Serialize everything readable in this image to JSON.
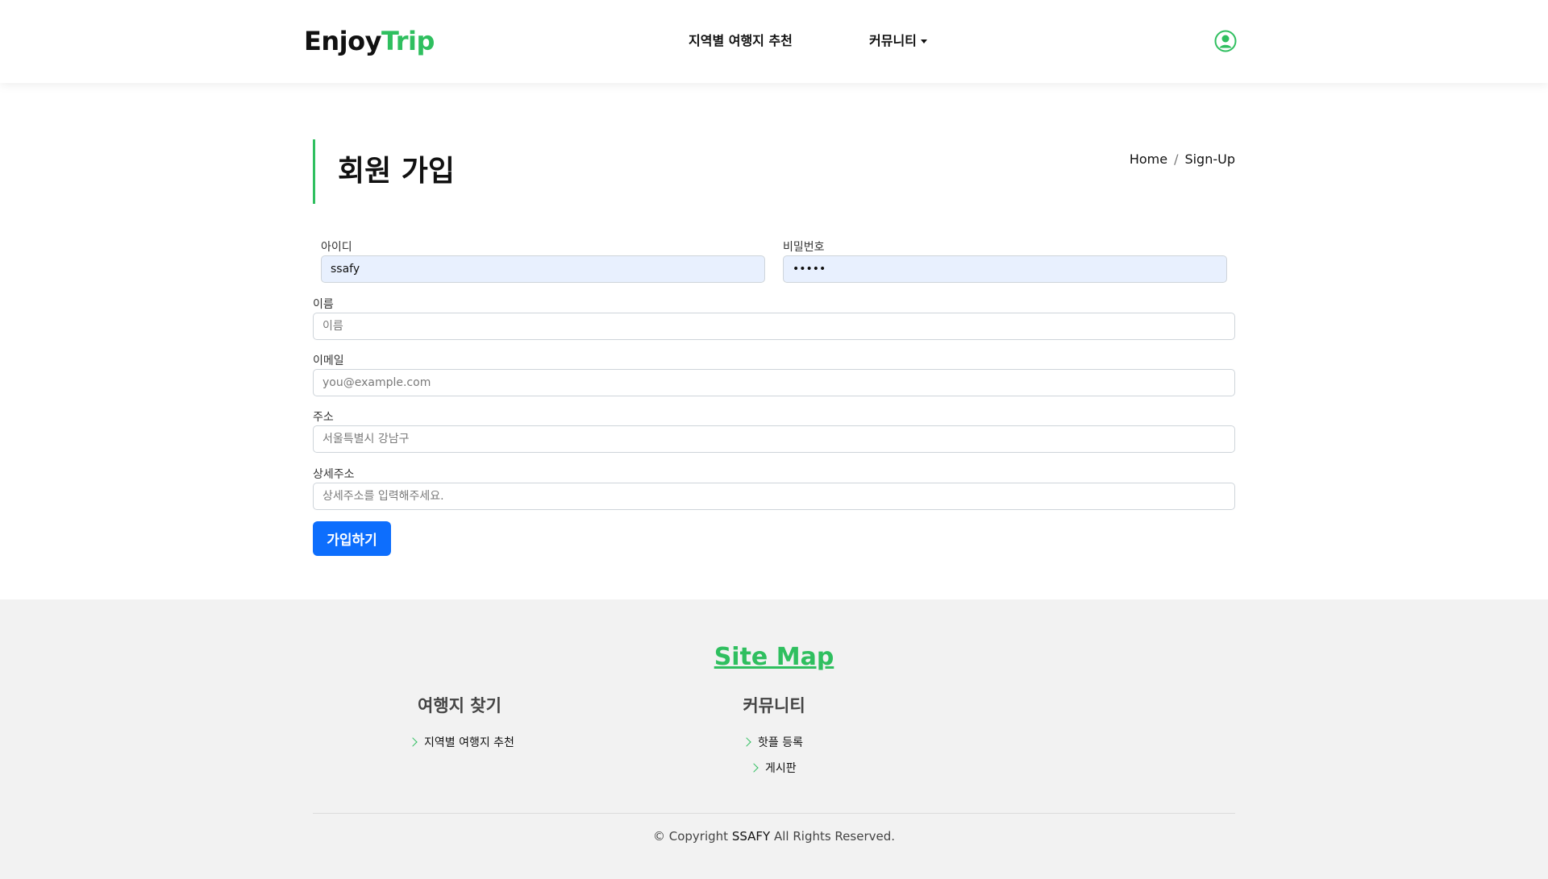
{
  "header": {
    "logo_part1": "Enjoy",
    "logo_part2": "Trip",
    "nav": [
      {
        "label": "지역별 여행지 추천"
      },
      {
        "label": "커뮤니티"
      }
    ]
  },
  "page": {
    "title": "회원 가입",
    "breadcrumb": [
      "Home",
      "/",
      "Sign-Up"
    ]
  },
  "form": {
    "id_label": "아이디",
    "id_value": "ssafy",
    "password_label": "비밀번호",
    "password_value": "ssafy",
    "name_label": "이름",
    "name_placeholder": "이름",
    "email_label": "이메일",
    "email_placeholder": "you@example.com",
    "address_label": "주소",
    "address_placeholder": "서울특별시 강남구",
    "detail_address_label": "상세주소",
    "detail_address_placeholder": "상세주소를 입력해주세요.",
    "submit_label": "가입하기"
  },
  "footer": {
    "sitemap_title": "Site Map",
    "columns": [
      {
        "title": "여행지 찾기",
        "links": [
          "지역별 여행지 추천"
        ]
      },
      {
        "title": "커뮤니티",
        "links": [
          "핫플 등록",
          "게시판"
        ]
      }
    ],
    "copyright_prefix": "© Copyright",
    "copyright_brand": "SSAFY",
    "copyright_suffix": "All Rights Reserved."
  },
  "colors": {
    "brand_green": "#2fbf5f",
    "primary_button": "#0d6efd",
    "autofill_bg": "#e8f0fe",
    "footer_bg": "#f2f2f2"
  },
  "icons": {
    "user": "user-circle-icon",
    "nav_dropdown": "caret-down-icon",
    "footer_link": "chevron-right-icon"
  }
}
